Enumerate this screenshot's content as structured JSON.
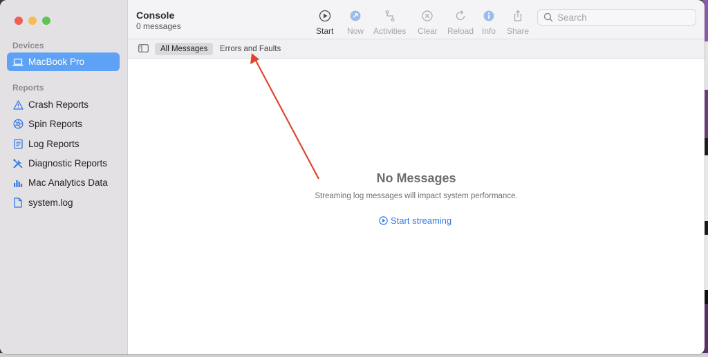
{
  "window": {
    "title": "Console",
    "subtitle": "0 messages"
  },
  "sidebar": {
    "devices_header": "Devices",
    "device": "MacBook Pro",
    "reports_header": "Reports",
    "items": [
      {
        "label": "Crash Reports",
        "icon": "warning-icon"
      },
      {
        "label": "Spin Reports",
        "icon": "spin-icon"
      },
      {
        "label": "Log Reports",
        "icon": "document-icon"
      },
      {
        "label": "Diagnostic Reports",
        "icon": "tools-icon"
      },
      {
        "label": "Mac Analytics Data",
        "icon": "bar-chart-icon"
      },
      {
        "label": "system.log",
        "icon": "file-icon"
      }
    ]
  },
  "toolbar": {
    "start": "Start",
    "now": "Now",
    "activities": "Activities",
    "clear": "Clear",
    "reload": "Reload",
    "info": "Info",
    "share": "Share",
    "search_placeholder": "Search"
  },
  "filters": {
    "all": "All Messages",
    "errors": "Errors and Faults"
  },
  "content": {
    "empty_title": "No Messages",
    "empty_sub": "Streaming log messages will impact system performance.",
    "start_streaming": "Start streaming"
  },
  "colors": {
    "accent": "#2f78e6",
    "selection": "#5da2f5",
    "annotation_arrow": "#e0442b"
  }
}
